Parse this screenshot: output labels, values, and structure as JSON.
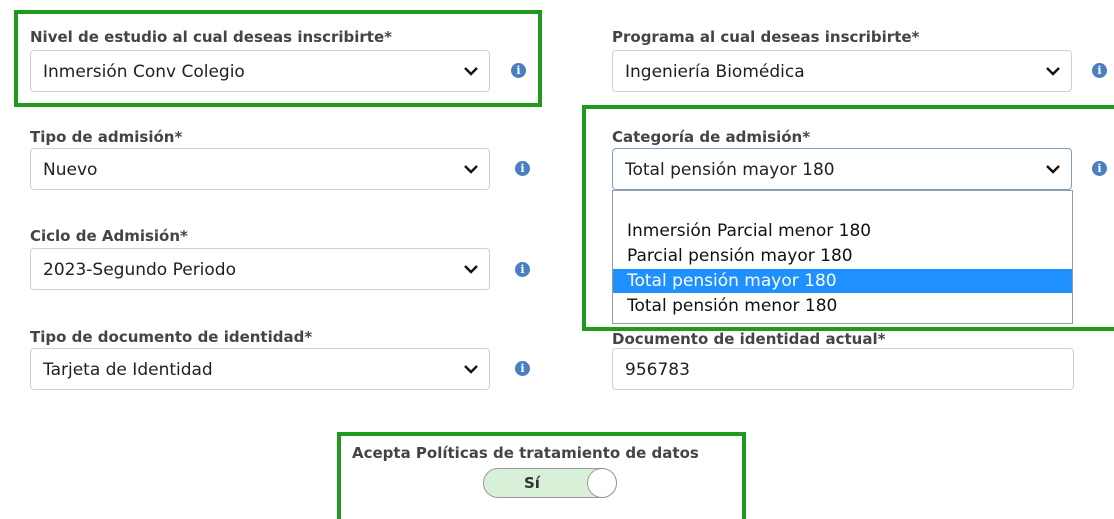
{
  "fields": {
    "nivel": {
      "label": "Nivel de estudio al cual deseas inscribirte*",
      "value": "Inmersión Conv Colegio"
    },
    "programa": {
      "label": "Programa al cual deseas inscribirte*",
      "value": "Ingeniería Biomédica"
    },
    "tipo_admision": {
      "label": "Tipo de admisión*",
      "value": "Nuevo"
    },
    "categoria": {
      "label": "Categoría de admisión*",
      "value": "Total pensión mayor 180",
      "options": [
        "Inmersión Parcial menor 180",
        "Parcial pensión mayor 180",
        "Total pensión mayor 180",
        "Total pensión menor 180"
      ],
      "selected_option": "Total pensión mayor 180"
    },
    "ciclo": {
      "label": "Ciclo de Admisión*",
      "value": "2023-Segundo Periodo"
    },
    "tipo_documento": {
      "label": "Tipo de documento de identidad*",
      "value": "Tarjeta de Identidad"
    },
    "documento_actual": {
      "label": "Documento de identidad actual*",
      "value": "956783"
    }
  },
  "consent": {
    "label": "Acepta Políticas de tratamiento de datos",
    "toggle_value": "Sí",
    "checked": true
  },
  "icons": {
    "info": "info-circle-icon",
    "dropdown": "chevron-down-icon"
  },
  "colors": {
    "highlight": "#1f9a1f",
    "info": "#4a7fc1",
    "option_selected": "#1e90ff",
    "toggle_on": "#d8f0d8"
  }
}
